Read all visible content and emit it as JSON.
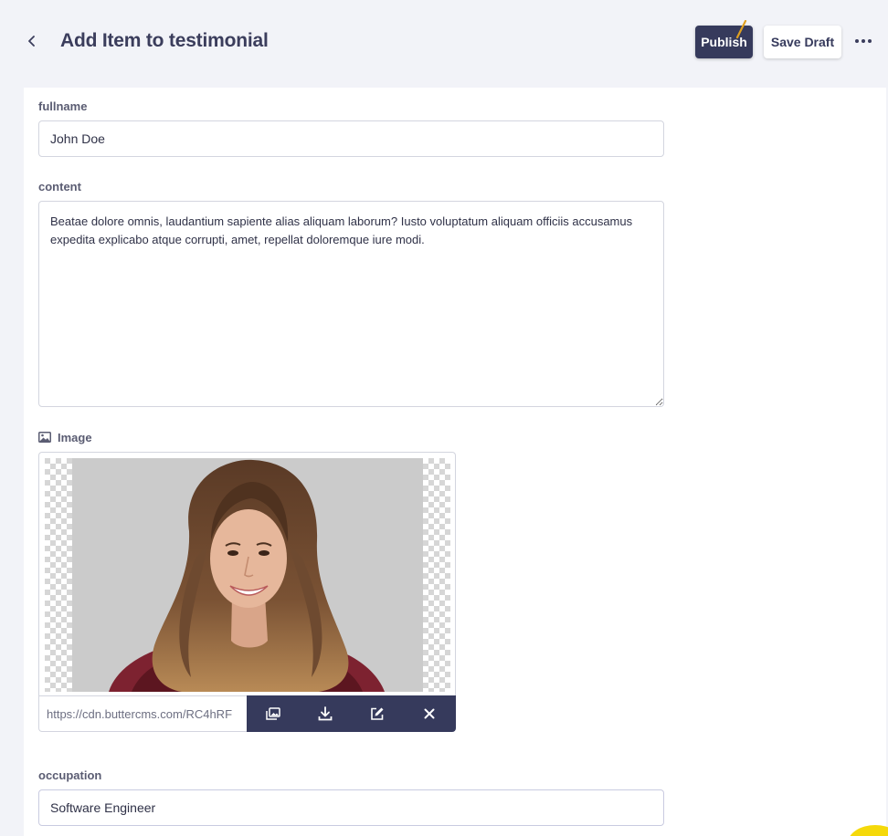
{
  "header": {
    "title": "Add Item to testimonial",
    "publish_label": "Publish",
    "save_draft_label": "Save Draft"
  },
  "fields": {
    "fullname": {
      "label": "fullname",
      "value": "John Doe"
    },
    "content": {
      "label": "content",
      "value": "Beatae dolore omnis, laudantium sapiente alias aliquam laborum? Iusto voluptatum aliquam officiis accusamus expedita explicabo atque corrupti, amet, repellat doloremque iure modi."
    },
    "image": {
      "label": "Image",
      "url": "https://cdn.buttercms.com/RC4hRF"
    },
    "occupation": {
      "label": "occupation",
      "value": "Software Engineer"
    }
  },
  "colors": {
    "primary": "#363a5c",
    "page_background": "#f2f3f8",
    "accent": "#f5d90a"
  },
  "icons": {
    "back": "chevron-left-icon",
    "more": "more-horizontal-icon",
    "image_label": "image-icon",
    "toolbar": [
      "media-library-icon",
      "download-icon",
      "edit-icon",
      "close-icon"
    ]
  }
}
